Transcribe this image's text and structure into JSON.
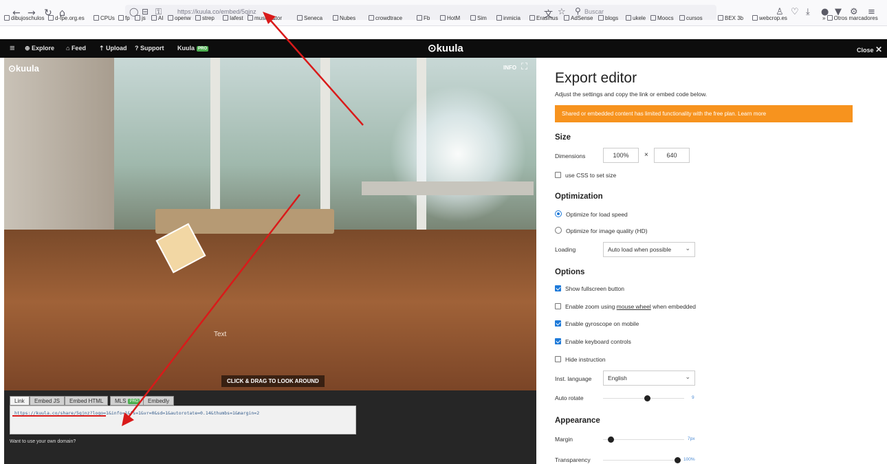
{
  "browser": {
    "url": "https://kuula.co/embed/5qjnz",
    "search_placeholder": "Buscar",
    "bookmarks": [
      "dibujoschulos",
      "d-fpe.org.es",
      "CPUs",
      "fp",
      "js",
      "AI",
      "openw",
      "strep",
      "Iafest",
      "musica&tor",
      "Seneca",
      "Nubes",
      "crowdtrace",
      "Fb",
      "HotM",
      "Sim",
      "inmicia",
      "Erasmus",
      "AdSense",
      "blogs",
      "ukele",
      "Moocs",
      "cursos",
      "BEX 3b",
      "webcrop.es"
    ],
    "other_bookmarks": "Otros marcadores"
  },
  "kuula_header": {
    "explore": "Explore",
    "feed": "Feed",
    "upload": "Upload",
    "support": "Support",
    "kuula_pro": "Kuula",
    "pro_badge": "PRO",
    "logo": "kuula",
    "close": "Close"
  },
  "viewer": {
    "logo": "kuula",
    "info": "INFO",
    "hotspot_text": "Text",
    "drag_hint": "CLICK & DRAG TO LOOK AROUND"
  },
  "code_panel": {
    "tabs": [
      "Link",
      "Embed JS",
      "Embed HTML",
      "MLS",
      "Embedly"
    ],
    "mls_badge": "PRO",
    "code": "https://kuula.co/share/5qjnz?logo=1&info=1&fs=1&vr=0&sd=1&autorotate=0.14&thumbs=1&margin=2",
    "own_domain": "Want to use your own domain?"
  },
  "editor": {
    "title": "Export editor",
    "description": "Adjust the settings and copy the link or embed code below.",
    "banner": "Shared or embedded content has limited functionality with the free plan. Learn more",
    "size": {
      "heading": "Size",
      "dimensions_label": "Dimensions",
      "width": "100%",
      "times": "×",
      "height": "640",
      "css_label": "use CSS to set size"
    },
    "optimization": {
      "heading": "Optimization",
      "load_speed": "Optimize for load speed",
      "image_quality": "Optimize for image quality (HD)",
      "loading_label": "Loading",
      "loading_value": "Auto load when possible"
    },
    "options": {
      "heading": "Options",
      "fullscreen": "Show fullscreen button",
      "zoom_pre": "Enable zoom using",
      "zoom_link": "mouse wheel",
      "zoom_post": "when embedded",
      "gyroscope": "Enable gyroscope on mobile",
      "keyboard": "Enable keyboard controls",
      "hide_instruction": "Hide instruction",
      "inst_language_label": "Inst. language",
      "inst_language_value": "English",
      "auto_rotate_label": "Auto rotate",
      "auto_rotate_value": "9",
      "auto_rotate_level": 0.55
    },
    "appearance": {
      "heading": "Appearance",
      "margin_label": "Margin",
      "margin_value": "7px",
      "margin_level": 0.1,
      "transparency_label": "Transparency",
      "transparency_value": "100%",
      "transparency_level": 1.0
    }
  },
  "colors": {
    "accent": "#1e7ad9",
    "banner": "#f7931e",
    "annotation_red": "#d91a1a"
  }
}
